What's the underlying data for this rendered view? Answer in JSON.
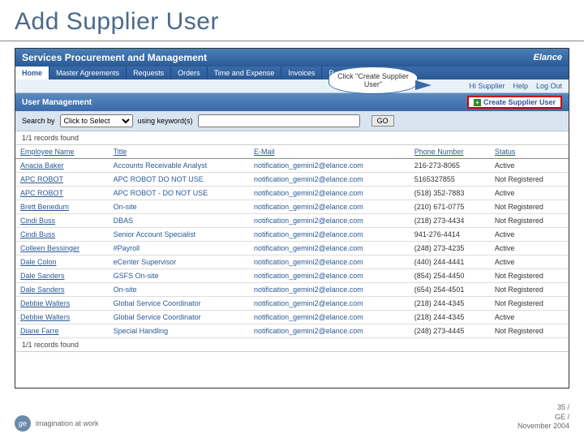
{
  "slide_title": "Add Supplier User",
  "app_title": "Services Procurement and Management",
  "brand": "Elance",
  "menu": [
    "Home",
    "Master Agreements",
    "Requests",
    "Orders",
    "Time and Expense",
    "Invoices",
    "Reporting"
  ],
  "subnav": {
    "role": "Hi Supplier",
    "help": "Help",
    "logout": "Log Out"
  },
  "panel": {
    "title": "User Management",
    "create_btn": "Create Supplier User"
  },
  "search": {
    "label": "Search by",
    "select_placeholder": "Click to Select",
    "hint": "using keyword(s)",
    "go": "GO"
  },
  "callout": "Click \"Create Supplier User\"",
  "records_msg": "1/1 records found",
  "columns": [
    "Employee Name",
    "Title",
    "E-Mail",
    "Phone Number",
    "Status"
  ],
  "rows": [
    {
      "name": "Anacia Baker",
      "title": "Accounts Receivable Analyst",
      "email": "notification_gemini2@elance.com",
      "phone": "216-273-8065",
      "status": "Active"
    },
    {
      "name": "APC ROBOT",
      "title": "APC ROBOT DO NOT USE",
      "email": "notification_gemini2@elance.com",
      "phone": "5165327855",
      "status": "Not Registered"
    },
    {
      "name": "APC ROBOT",
      "title": "APC ROBOT - DO NOT USE",
      "email": "notification_gemini2@elance.com",
      "phone": "(518) 352-7883",
      "status": "Active"
    },
    {
      "name": "Brett Benedum",
      "title": "On-site",
      "email": "notification_gemini2@elance.com",
      "phone": "(210) 671-0775",
      "status": "Not Registered"
    },
    {
      "name": "Cindi Buss",
      "title": "DBAS",
      "email": "notification_gemini2@elance.com",
      "phone": "(218) 273-4434",
      "status": "Not Registered"
    },
    {
      "name": "Cindi Buss",
      "title": "Senior Account Specialist",
      "email": "notification_gemini2@elance.com",
      "phone": "941-276-4414",
      "status": "Active"
    },
    {
      "name": "Colleen Bessinger",
      "title": "#Payroll",
      "email": "notification_gemini2@elance.com",
      "phone": "(248) 273-4235",
      "status": "Active"
    },
    {
      "name": "Dale Colon",
      "title": "eCenter Supervisor",
      "email": "notification_gemini2@elance.com",
      "phone": "(440) 244-4441",
      "status": "Active"
    },
    {
      "name": "Dale Sanders",
      "title": "GSFS On-site",
      "email": "notification_gemini2@elance.com",
      "phone": "(854) 254-4450",
      "status": "Not Registered"
    },
    {
      "name": "Dale Sanders",
      "title": "On-site",
      "email": "notification_gemini2@elance.com",
      "phone": "(654) 254-4501",
      "status": "Not Registered"
    },
    {
      "name": "Debbie Walters",
      "title": "Global Service Coordinator",
      "email": "notification_gemini2@elance.com",
      "phone": "(218) 244-4345",
      "status": "Not Registered"
    },
    {
      "name": "Debbie Walters",
      "title": "Global Service Coordinator",
      "email": "notification_gemini2@elance.com",
      "phone": "(218) 244-4345",
      "status": "Active"
    },
    {
      "name": "Diane Farre",
      "title": "Special Handling",
      "email": "notification_gemini2@elance.com",
      "phone": "(248) 273-4445",
      "status": "Not Registered"
    }
  ],
  "footer": {
    "tagline": "imagination at work",
    "page": "35 /",
    "co": "GE /",
    "date": "November 2004"
  }
}
